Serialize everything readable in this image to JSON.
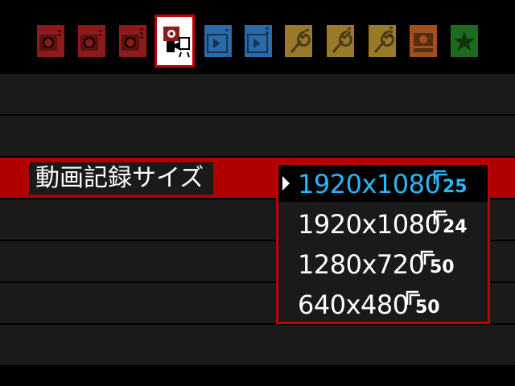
{
  "menu": {
    "selected_item_label": "動画記録サイズ"
  },
  "options": [
    {
      "text": "1920x1080",
      "frame_rate": "25",
      "current": true
    },
    {
      "text": "1920x1080",
      "frame_rate": "24",
      "current": false
    },
    {
      "text": "1280x720",
      "frame_rate": "50",
      "current": false
    },
    {
      "text": "640x480",
      "frame_rate": "50",
      "current": false
    }
  ],
  "colors": {
    "highlight_red": "#b00000",
    "current_option_blue": "#29b6f6",
    "shooting_tab": "#8e1b1b",
    "playback_tab": "#2a6aa8",
    "setup_tab": "#9a7a2a",
    "custom_tab": "#a0501c",
    "mymenu_tab": "#1e6a1e"
  },
  "tabs": [
    {
      "icon": "camera-icon",
      "kind": "shooting"
    },
    {
      "icon": "camera-icon",
      "kind": "shooting"
    },
    {
      "icon": "camera-icon",
      "kind": "shooting"
    },
    {
      "icon": "movie-camera-icon",
      "kind": "movie",
      "active": true
    },
    {
      "icon": "playback-icon",
      "kind": "playback"
    },
    {
      "icon": "playback-icon",
      "kind": "playback"
    },
    {
      "icon": "wrench-icon",
      "kind": "setup"
    },
    {
      "icon": "wrench-icon",
      "kind": "setup"
    },
    {
      "icon": "wrench-icon",
      "kind": "setup"
    },
    {
      "icon": "custom-function-camera-icon",
      "kind": "custom"
    },
    {
      "icon": "star-icon",
      "kind": "mymenu"
    }
  ]
}
